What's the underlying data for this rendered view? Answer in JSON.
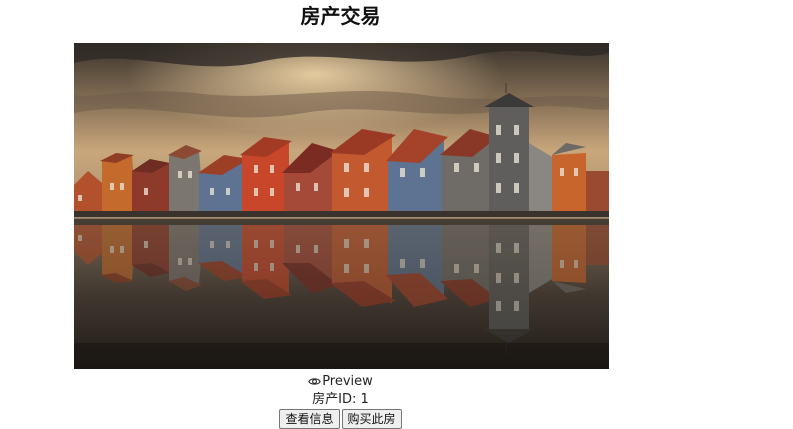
{
  "page": {
    "title": "房产交易"
  },
  "listing": {
    "preview_label": "Preview",
    "id_text": "房产ID: 1",
    "view_button": "查看信息",
    "buy_button": "购买此房"
  },
  "icons": {
    "preview": "eye-icon"
  }
}
